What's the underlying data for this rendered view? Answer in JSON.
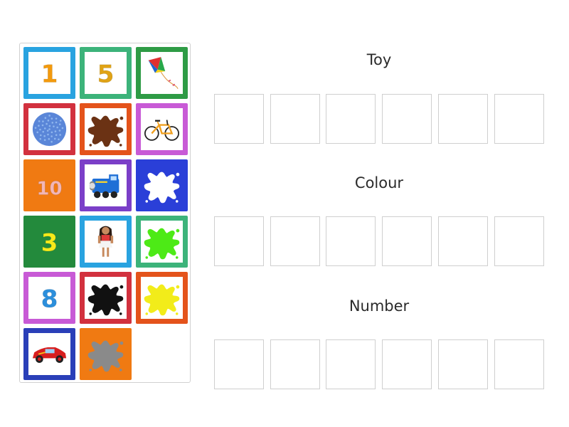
{
  "categories": [
    {
      "label": "Toy",
      "slot_count": 6
    },
    {
      "label": "Colour",
      "slot_count": 6
    },
    {
      "label": "Number",
      "slot_count": 6
    }
  ],
  "tiles": [
    {
      "kind": "number",
      "text": "1",
      "frame": "#29a3e0",
      "glyph": "#f39a0d"
    },
    {
      "kind": "number",
      "text": "5",
      "frame": "#3cb37a",
      "glyph": "#e0a316"
    },
    {
      "kind": "kite",
      "frame": "#2e9b45"
    },
    {
      "kind": "ball",
      "frame": "#d2313e"
    },
    {
      "kind": "splat",
      "color": "#6b3214",
      "frame": "#e4531b"
    },
    {
      "kind": "bicycle",
      "frame": "#c85ad6"
    },
    {
      "kind": "number",
      "text": "10",
      "frame": "#f07a12",
      "glyph": "#f2b6b6",
      "bg": "#f07a12"
    },
    {
      "kind": "train",
      "frame": "#7b3fc8"
    },
    {
      "kind": "splat",
      "color": "#ffffff",
      "frame": "#2a3fd8",
      "bg": "#2a3fd8"
    },
    {
      "kind": "number",
      "text": "3",
      "frame": "#238a3c",
      "glyph": "#f5ea1a",
      "bg": "#238a3c"
    },
    {
      "kind": "doll",
      "frame": "#29a3e0"
    },
    {
      "kind": "splat",
      "color": "#4dea16",
      "frame": "#3cb37a"
    },
    {
      "kind": "number",
      "text": "8",
      "frame": "#c85ad6",
      "glyph": "#2c8fdc"
    },
    {
      "kind": "splat",
      "color": "#111111",
      "frame": "#d2313e"
    },
    {
      "kind": "splat",
      "color": "#f2ec1a",
      "frame": "#e4531b"
    },
    {
      "kind": "car",
      "frame": "#2a3fb8"
    },
    {
      "kind": "splat",
      "color": "#8a8a8a",
      "frame": "#f07a12",
      "bg": "#f07a12"
    }
  ]
}
